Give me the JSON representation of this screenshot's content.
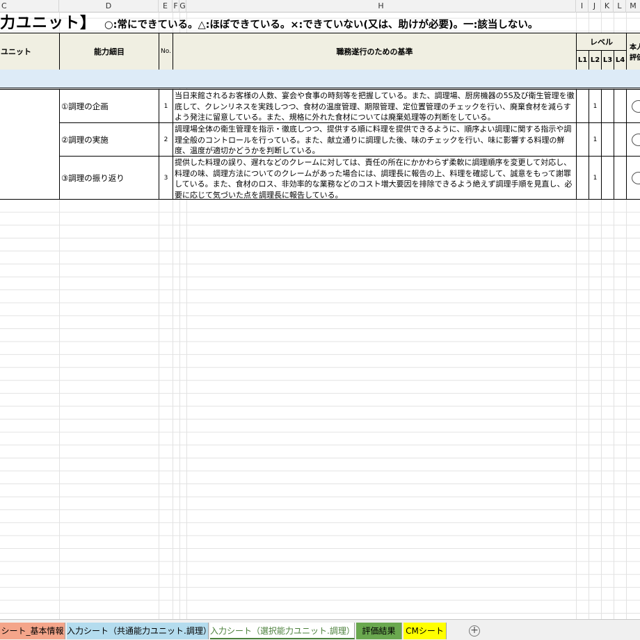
{
  "column_headers": [
    "C",
    "D",
    "E",
    "F",
    "G",
    "H",
    "I",
    "J",
    "K",
    "L",
    "M"
  ],
  "title": "力ユニット】",
  "legend": "○:常にできている。△:ほぼできている。×:できていない(又は、助けが必要)。一:該当しない。",
  "table_header": {
    "unit": "ユニット",
    "detail": "能力細目",
    "no": "No.",
    "criteria": "職務遂行のための基準",
    "level": "レベル",
    "l1": "L1",
    "l2": "L2",
    "l3": "L3",
    "l4": "L4",
    "self_eval": "本人\n評価"
  },
  "rows": [
    {
      "detail": "①調理の企画",
      "no": "1",
      "criteria": "当日来館されるお客様の人数、宴会や食事の時刻等を把握している。また、調理場、厨房機器の5S及び衛生管理を徹底して、クレンリネスを実践しつつ、食材の温度管理、期限管理、定位置管理のチェックを行い、廃棄食材を減らすよう発注に留意している。また、規格に外れた食材については廃棄処理等の判断をしている。",
      "l2": "1"
    },
    {
      "detail": "②調理の実施",
      "no": "2",
      "criteria": "調理場全体の衛生管理を指示・徹底しつつ、提供する順に料理を提供できるように、順序よい調理に関する指示や調理全般のコントロールを行っている。また、献立通りに調理した後、味のチェックを行い、味に影響する料理の鮮度、温度が適切かどうかを判断している。",
      "l2": "1"
    },
    {
      "detail": "③調理の振り返り",
      "no": "3",
      "criteria": "提供した料理の誤り、遅れなどのクレームに対しては、責任の所在にかかわらず柔軟に調理順序を変更して対応し、料理の味、調理方法についてのクレームがあった場合には、調理長に報告の上、料理を確認して、誠意をもって謝罪している。また、食材のロス、非効率的な業務などのコスト増大要因を排除できるよう絶えず調理手順を見直し、必要に応じて気づいた点を調理長に報告している。",
      "l2": "1"
    }
  ],
  "sheet_tabs": [
    {
      "label": "シート_基本情報",
      "color": "#f4a58a",
      "active": false
    },
    {
      "label": "入力シート（共通能力ユニット.調理）",
      "color": "#b4dcee",
      "active": false
    },
    {
      "label": "入力シート（選択能力ユニット.調理）",
      "color": "#ffffff",
      "active": true
    },
    {
      "label": "評価結果",
      "color": "#6aa84f",
      "active": false
    },
    {
      "label": "CMシート",
      "color": "#ffff00",
      "active": false
    }
  ],
  "add_sheet_icon": "plus-circle-icon"
}
